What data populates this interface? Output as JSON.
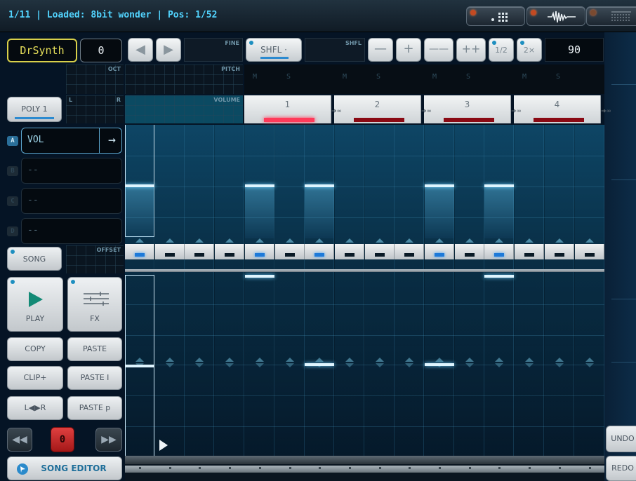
{
  "status": {
    "text": "1/11 | Loaded: 8bit wonder | Pos: 1/52"
  },
  "mode_buttons": [
    {
      "icon": "pad-grid-icon"
    },
    {
      "icon": "waveform-icon"
    },
    {
      "icon": "mixer-icon"
    }
  ],
  "instrument": {
    "name": "DrSynth",
    "number": "0"
  },
  "toolbar": {
    "fine_label": "FINE",
    "shfl_button": "SHFL ·",
    "shfl_label": "SHFL",
    "minus": "—",
    "plus": "+",
    "minusminus": "——",
    "plusplus": "++",
    "half": "1/2",
    "double": "2×",
    "tempo": "90"
  },
  "labels": {
    "oct": "OCT",
    "pitch": "PITCH",
    "l": "L",
    "r": "R",
    "volume": "VOLUME",
    "offset": "OFFSET"
  },
  "mute_solo": [
    "M",
    "S"
  ],
  "poly_button": "POLY 1",
  "patterns": [
    "1",
    "2",
    "3",
    "4"
  ],
  "slots": [
    {
      "letter": "A",
      "value": "VOL"
    },
    {
      "letter": "B",
      "value": "--"
    },
    {
      "letter": "C",
      "value": "--"
    },
    {
      "letter": "D",
      "value": "--"
    }
  ],
  "buttons": {
    "song": "SONG",
    "play": "PLAY",
    "fx": "FX",
    "copy": "COPY",
    "paste": "PASTE",
    "clip_plus": "CLIP+",
    "paste_i": "PASTE I",
    "lr": "L◀▶R",
    "paste_p": "PASTE p",
    "counter": "0",
    "song_editor": "SONG EDITOR",
    "undo": "UNDO",
    "redo": "REDO"
  },
  "steps": {
    "upper_active": [
      true,
      false,
      false,
      false,
      true,
      false,
      true,
      false,
      false,
      false,
      true,
      false,
      true,
      false,
      false,
      false
    ],
    "lower_active": [
      false,
      false,
      false,
      false,
      true,
      false,
      false,
      false,
      false,
      false,
      false,
      false,
      true,
      false,
      false,
      false
    ],
    "lower_mid_active": [
      false,
      false,
      false,
      false,
      false,
      false,
      true,
      false,
      false,
      false,
      true,
      false,
      false,
      false,
      false,
      false
    ]
  },
  "colors": {
    "accent": "#52d4ff",
    "active_pattern": "#ff3a5a",
    "step_on": "#1e7ad8"
  }
}
